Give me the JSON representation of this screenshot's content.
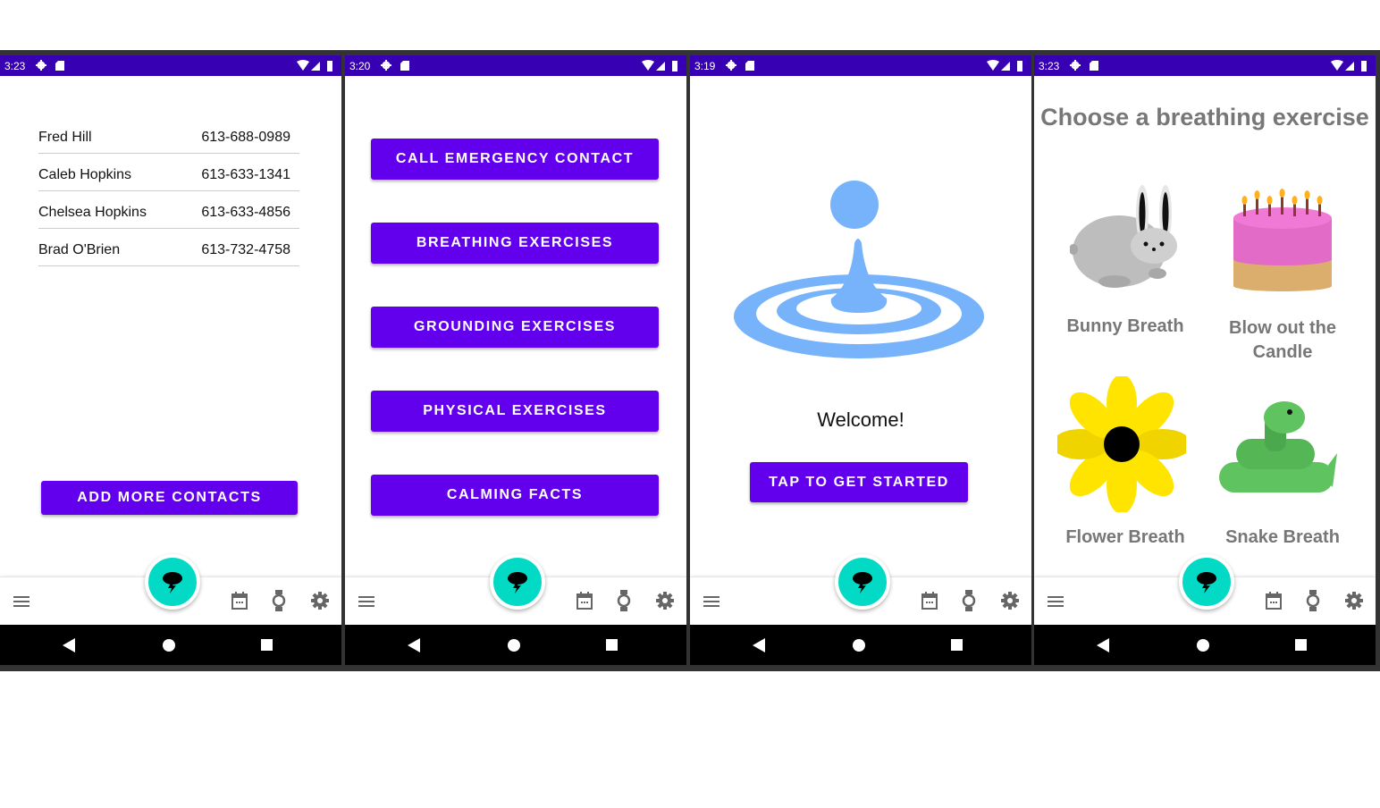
{
  "screens": [
    {
      "status_time": "3:23",
      "contacts": [
        {
          "name": "Fred Hill",
          "phone": "613-688-0989"
        },
        {
          "name": "Caleb Hopkins",
          "phone": "613-633-1341"
        },
        {
          "name": "Chelsea Hopkins",
          "phone": "613-633-4856"
        },
        {
          "name": "Brad O'Brien",
          "phone": "613-732-4758"
        }
      ],
      "add_button": "ADD MORE CONTACTS"
    },
    {
      "status_time": "3:20",
      "menu_buttons": [
        "CALL EMERGENCY CONTACT",
        "BREATHING EXERCISES",
        "GROUNDING EXERCISES",
        "PHYSICAL EXERCISES",
        "CALMING FACTS"
      ]
    },
    {
      "status_time": "3:19",
      "welcome": "Welcome!",
      "start_button": "TAP TO GET STARTED"
    },
    {
      "status_time": "3:23",
      "title": "Choose a breathing exercise",
      "exercises": [
        "Bunny Breath",
        "Blow out the Candle",
        "Flower Breath",
        "Snake Breath"
      ]
    }
  ],
  "icons": {
    "status": [
      "gear-icon",
      "sd-card-icon",
      "wifi-icon",
      "signal-icon",
      "battery-icon"
    ],
    "bottom_nav": [
      "menu-icon",
      "storm-cloud-icon",
      "calendar-icon",
      "watch-icon",
      "settings-icon"
    ],
    "system_nav": [
      "back-icon",
      "home-icon",
      "recents-icon"
    ]
  },
  "colors": {
    "status_bar": "#3700b3",
    "primary": "#6200ee",
    "fab": "#03dac5",
    "water": "#76b3fa"
  }
}
